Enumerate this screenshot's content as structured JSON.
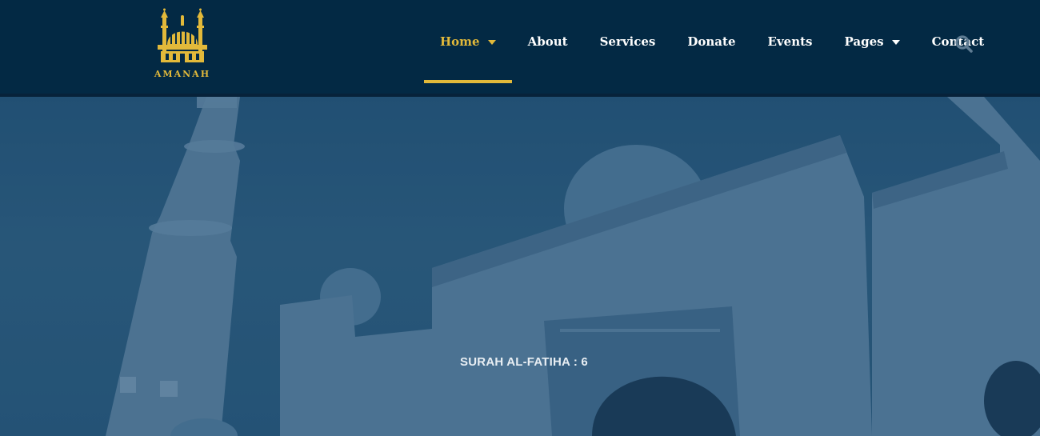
{
  "brand": {
    "name": "AMANAH",
    "accent_color": "#e2b93a",
    "nav_bg_color": "#032944",
    "logo_icon": "mosque-logo-icon"
  },
  "nav": {
    "items": [
      {
        "label": "Home",
        "has_dropdown": true,
        "active": true
      },
      {
        "label": "About",
        "has_dropdown": false,
        "active": false
      },
      {
        "label": "Services",
        "has_dropdown": false,
        "active": false
      },
      {
        "label": "Donate",
        "has_dropdown": false,
        "active": false
      },
      {
        "label": "Events",
        "has_dropdown": false,
        "active": false
      },
      {
        "label": "Pages",
        "has_dropdown": true,
        "active": false
      },
      {
        "label": "Contact",
        "has_dropdown": false,
        "active": false
      }
    ],
    "search_icon": "search-icon"
  },
  "hero": {
    "caption": "SURAH AL-FATIHA : 6",
    "background": "mosque-photo"
  }
}
